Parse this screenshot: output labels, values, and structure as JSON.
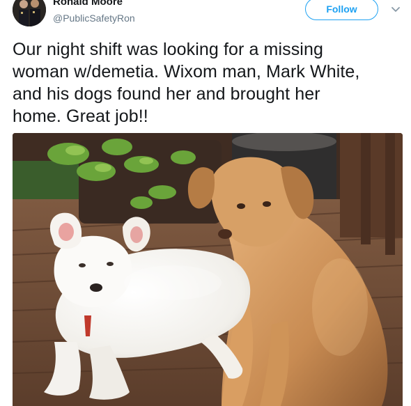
{
  "author": {
    "name": "Ronald Moore",
    "handle": "@PublicSafetyRon",
    "avatar_icon": "profile-photo"
  },
  "actions": {
    "follow_label": "Follow",
    "more_icon": "chevron-down-icon"
  },
  "tweet": {
    "lines": [
      "Our night shift was looking for a missing",
      "woman w/demetia. Wixom man, Mark White,",
      "and his dogs found her and brought her",
      "home. Great job!!"
    ]
  },
  "media": {
    "subject": "two dogs on a wooden deck"
  },
  "colors": {
    "accent": "#1da1f2",
    "text": "#14171a",
    "secondary_text": "#657786"
  }
}
